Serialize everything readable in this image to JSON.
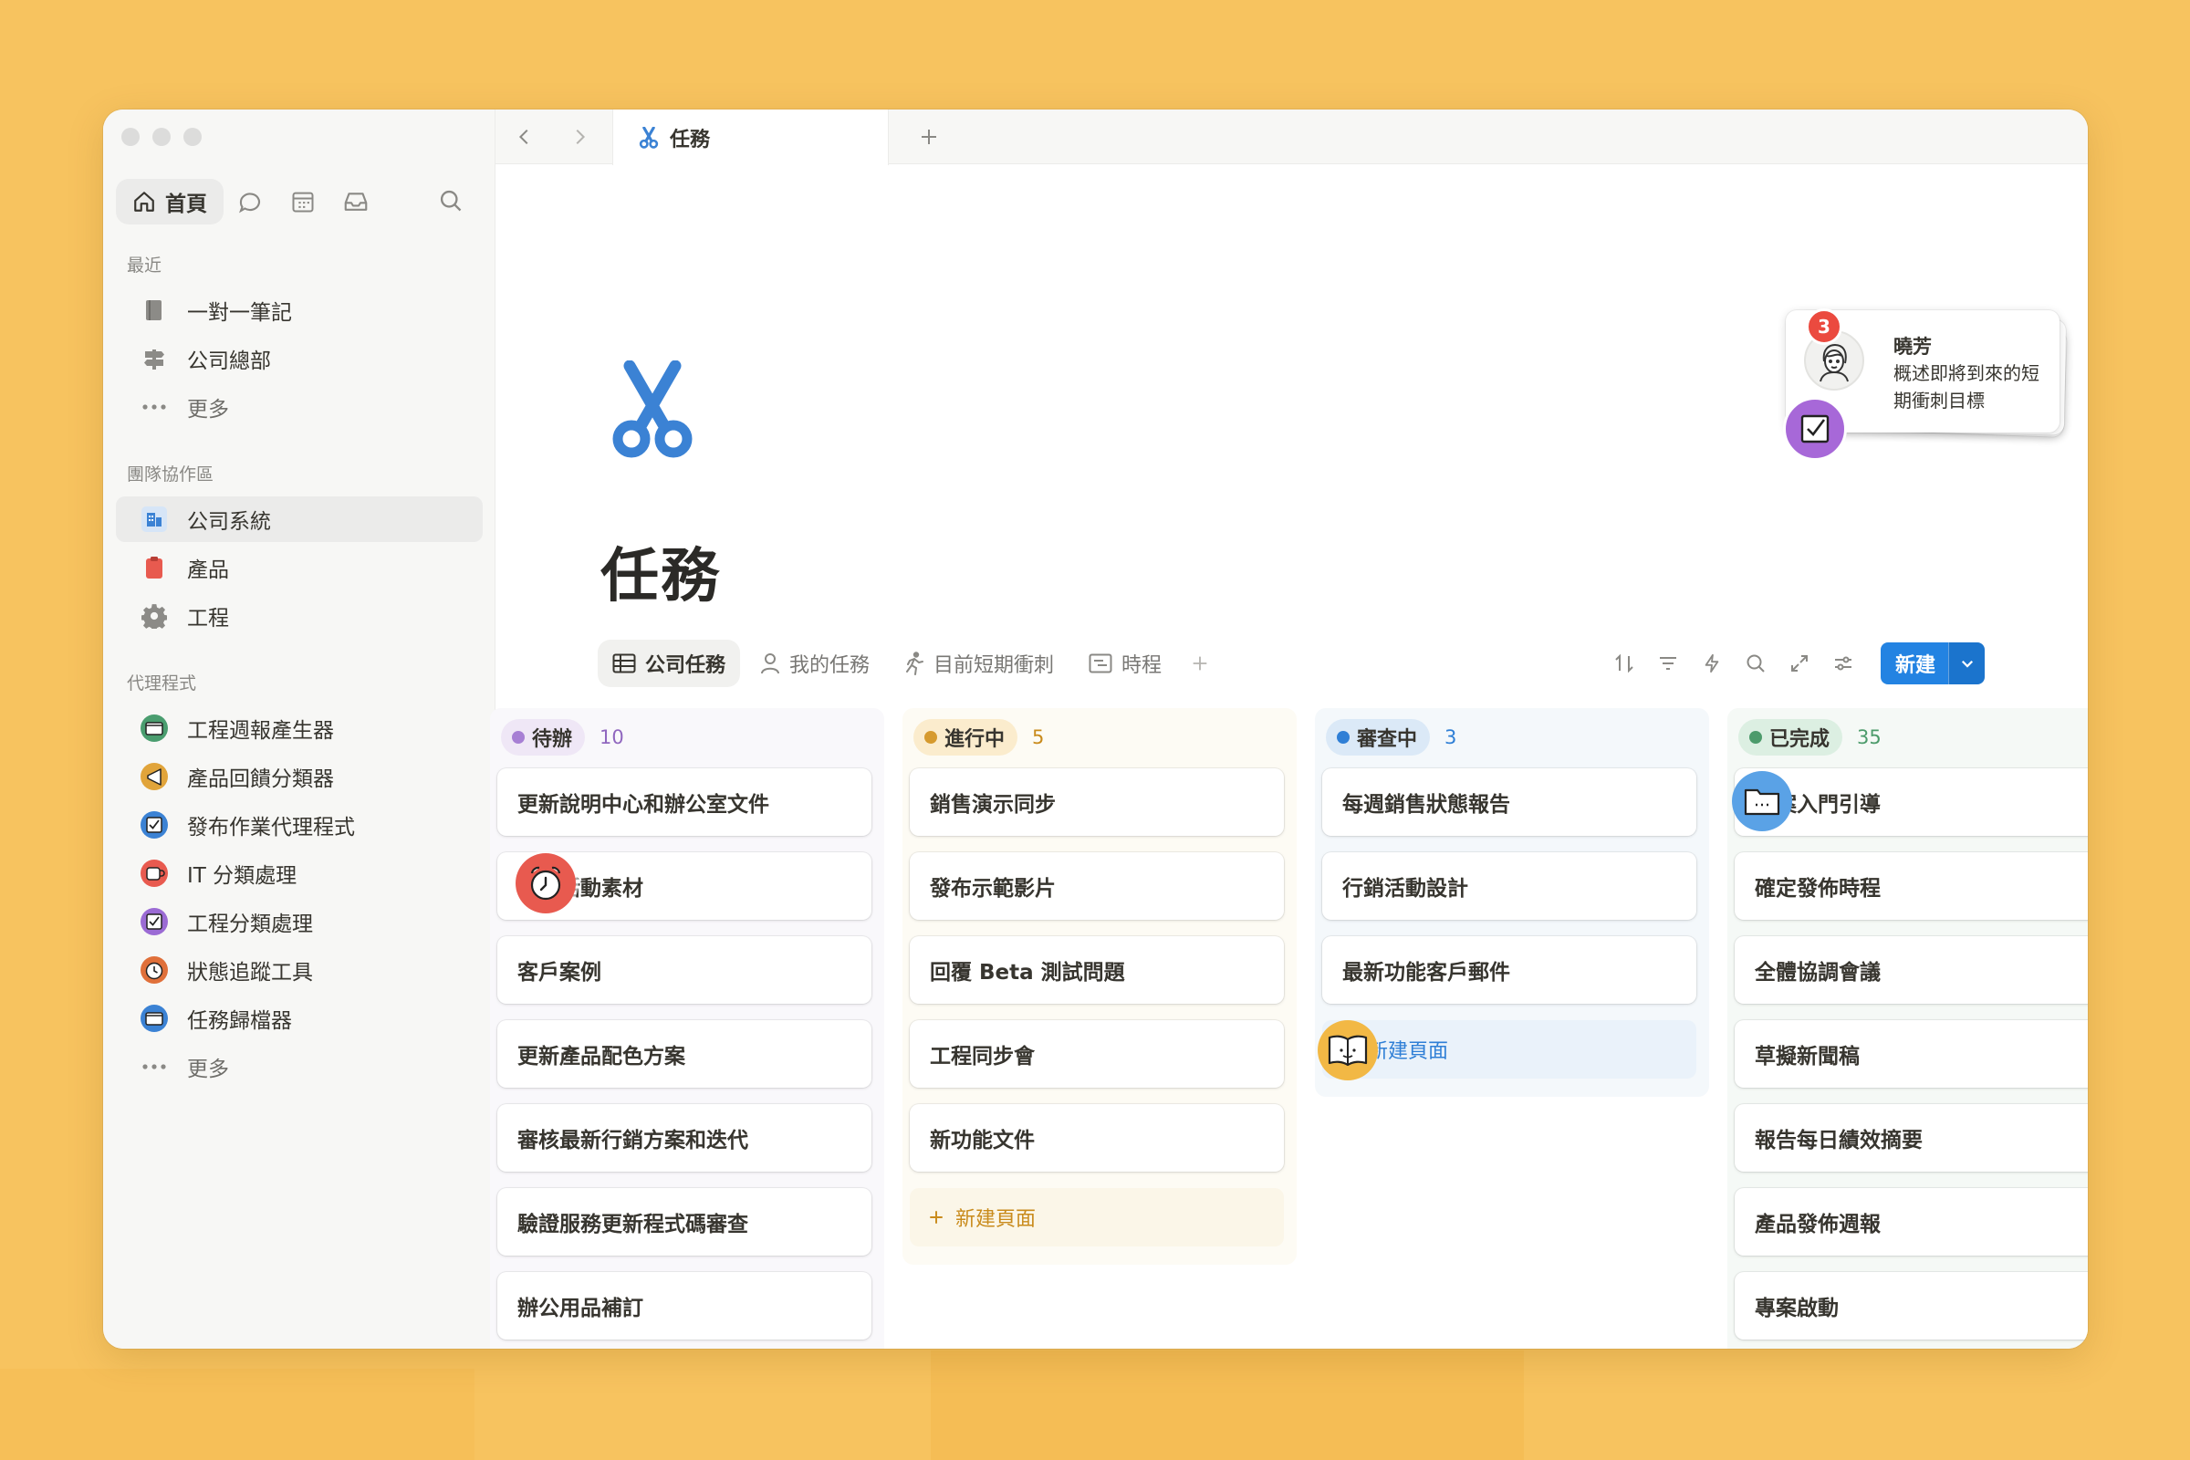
{
  "tab": {
    "title": "任務"
  },
  "sidebar": {
    "home_label": "首頁",
    "sections": {
      "recent": "最近",
      "team": "團隊協作區",
      "agents": "代理程式"
    },
    "recent_items": [
      {
        "label": "一對一筆記",
        "icon": "page-icon"
      },
      {
        "label": "公司總部",
        "icon": "signpost-icon"
      },
      {
        "label": "更多",
        "icon": "ellipsis-icon"
      }
    ],
    "team_items": [
      {
        "label": "公司系統",
        "icon": "building-icon",
        "active": true
      },
      {
        "label": "產品",
        "icon": "clipboard-icon"
      },
      {
        "label": "工程",
        "icon": "gear-icon"
      }
    ],
    "agent_items": [
      {
        "label": "工程週報產生器",
        "icon": "folder-agent-icon",
        "color": "#4a9d6f"
      },
      {
        "label": "產品回饋分類器",
        "icon": "megaphone-agent-icon",
        "color": "#e1a43a"
      },
      {
        "label": "發布作業代理程式",
        "icon": "checkbox-agent-icon",
        "color": "#3b82d4"
      },
      {
        "label": "IT 分類處理",
        "icon": "cup-agent-icon",
        "color": "#e85a4f"
      },
      {
        "label": "工程分類處理",
        "icon": "checkbox-agent-icon",
        "color": "#9b6bd4"
      },
      {
        "label": "狀態追蹤工具",
        "icon": "clock-agent-icon",
        "color": "#e0703a"
      },
      {
        "label": "任務歸檔器",
        "icon": "folder-agent-icon",
        "color": "#3b82d4"
      },
      {
        "label": "更多",
        "icon": "ellipsis-icon"
      }
    ]
  },
  "page": {
    "title": "任務",
    "views": [
      {
        "label": "公司任務",
        "icon": "table-icon",
        "active": true
      },
      {
        "label": "我的任務",
        "icon": "person-icon"
      },
      {
        "label": "目前短期衝刺",
        "icon": "runner-icon"
      },
      {
        "label": "時程",
        "icon": "timeline-icon"
      }
    ],
    "new_button": "新建"
  },
  "board": {
    "columns": [
      {
        "status": "待辦",
        "count": "10",
        "bg": "#f9f8fb",
        "pill_bg": "#efe7f6",
        "dot": "#a77fd4",
        "count_color": "#9067bf",
        "cards": [
          "更新說明中心和辦公室文件",
          "審核活動素材",
          "客戶案例",
          "更新產品配色方案",
          "審核最新行銷方案和迭代",
          "驗證服務更新程式碼審查",
          "辦公用品補訂"
        ]
      },
      {
        "status": "進行中",
        "count": "5",
        "bg": "#fdfbf4",
        "pill_bg": "#fbeccd",
        "dot": "#d69a2e",
        "count_color": "#c98b1c",
        "cards": [
          "銷售演示同步",
          "發布示範影片",
          "回覆 Beta 測試問題",
          "工程同步會",
          "新功能文件"
        ],
        "new_page": "新建頁面"
      },
      {
        "status": "審查中",
        "count": "3",
        "bg": "#f4f8fb",
        "pill_bg": "#dbe9f7",
        "dot": "#2f7fd6",
        "count_color": "#2f7fd6",
        "cards": [
          "每週銷售狀態報告",
          "行銷活動設計",
          "最新功能客戶郵件"
        ],
        "new_page": "新建頁面"
      },
      {
        "status": "已完成",
        "count": "35",
        "bg": "#f5f9f6",
        "pill_bg": "#dcefe2",
        "dot": "#4c9b6b",
        "count_color": "#4c9b6b",
        "cards": [
          "專案入門引導",
          "確定發佈時程",
          "全體協調會議",
          "草擬新聞稿",
          "報告每日績效摘要",
          "產品發佈週報",
          "專案啟動"
        ]
      }
    ]
  },
  "notification": {
    "badge": "3",
    "name": "曉芳",
    "message": "概述即將到來的短期衝刺目標"
  },
  "colors": {
    "accent": "#2383e2",
    "background": "#f7c35f"
  }
}
